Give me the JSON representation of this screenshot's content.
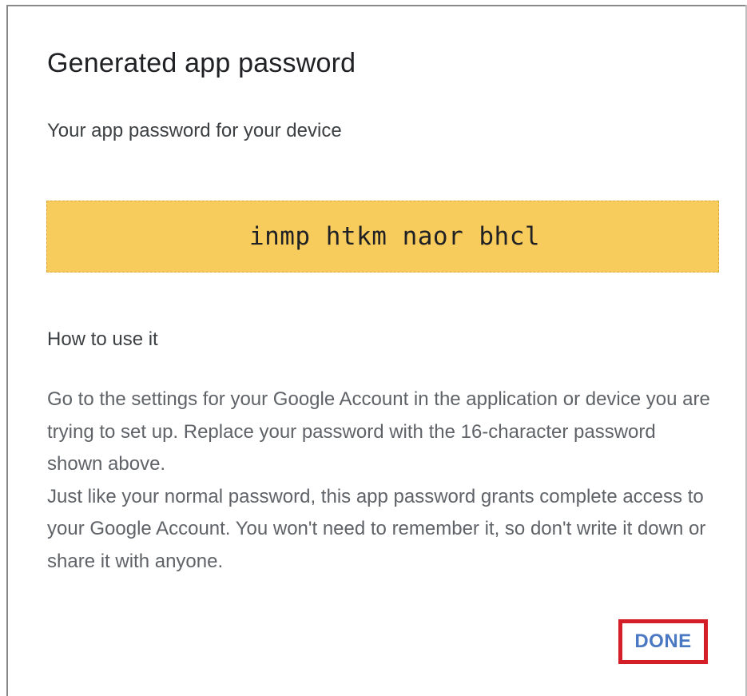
{
  "dialog": {
    "title": "Generated app password",
    "subtitle": "Your app password for your device",
    "password": "inmp htkm naor bhcl",
    "howto_heading": "How to use it",
    "instructions": [
      "Go to the settings for your Google Account in the application or device you are trying to set up. Replace your password with the 16-character password shown above.",
      "Just like your normal password, this app password grants complete access to your Google Account. You won't need to remember it, so don't write it down or share it with anyone."
    ],
    "done_label": "DONE"
  },
  "colors": {
    "password_background": "#f7cb5c",
    "done_text": "#4a78c2",
    "highlight_border": "#d51f28"
  }
}
